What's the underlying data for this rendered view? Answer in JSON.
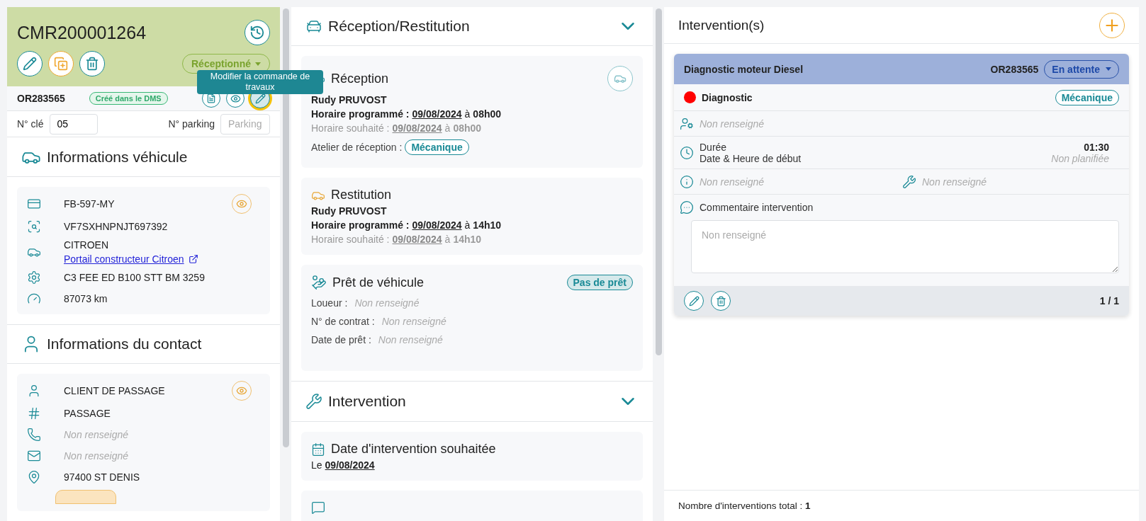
{
  "order": {
    "number": "CMR200001264",
    "status": "Réceptionné"
  },
  "work_order": {
    "number": "OR283565",
    "badge": "Créé dans le DMS",
    "edit_focused": true,
    "tooltip": "Modifier la commande de travaux"
  },
  "fields": [
    {
      "label": "N° clé",
      "value": "05"
    },
    {
      "label": "N° parking",
      "placeholder": "Parking"
    }
  ],
  "vehicle": {
    "title": "Informations véhicule",
    "rows": [
      {
        "kind": "plate",
        "text": "FB-597-MY",
        "missing": false
      },
      {
        "kind": "vin",
        "text": "VF7SXHNPNJT697392",
        "missing": false
      },
      {
        "kind": "brand",
        "text": "CITROEN",
        "missing": false,
        "link": "Portail constructeur Citroen"
      },
      {
        "kind": "engine",
        "text": "C3 FEE ED B100 STT BM 3259",
        "missing": false
      },
      {
        "kind": "mileage",
        "text": "87073 km",
        "missing": false
      }
    ]
  },
  "contact": {
    "title": "Informations du contact",
    "rows": [
      {
        "kind": "person",
        "text": "CLIENT DE PASSAGE",
        "missing": false
      },
      {
        "kind": "account",
        "text": "PASSAGE",
        "missing": false
      },
      {
        "kind": "phone",
        "text": "Non renseigné",
        "missing": true
      },
      {
        "kind": "email",
        "text": "Non renseigné",
        "missing": true
      },
      {
        "kind": "address",
        "text": "97400 ST DENIS",
        "missing": false
      }
    ]
  },
  "reception_restitution": {
    "title": "Réception/Restitution",
    "expanded": true,
    "reception": {
      "title": "Réception",
      "person": "Rudy PRUVOST",
      "scheduled": {
        "label": "Horaire programmé :",
        "date": "09/08/2024",
        "at": "à",
        "time": "08h00"
      },
      "desired": {
        "label": "Horaire souhaité :",
        "date": "09/08/2024",
        "at": "à",
        "time": "08h00"
      },
      "workshop": {
        "label": "Atelier de réception :",
        "value": "Mécanique"
      }
    },
    "restitution": {
      "title": "Restitution",
      "person": "Rudy PRUVOST",
      "scheduled": {
        "label": "Horaire programmé :",
        "date": "09/08/2024",
        "at": "à",
        "time": "14h10"
      },
      "desired": {
        "label": "Horaire souhaité :",
        "date": "09/08/2024",
        "at": "à",
        "time": "14h10"
      }
    },
    "loan": {
      "title": "Prêt de véhicule",
      "status": "Pas de prêt",
      "fields": [
        {
          "label": "Loueur :",
          "value": "Non renseigné",
          "missing": true
        },
        {
          "label": "N° de contrat :",
          "value": "Non renseigné",
          "missing": true
        },
        {
          "label": "Date de prêt :",
          "value": "Non renseigné",
          "missing": true
        }
      ]
    }
  },
  "intervention_section": {
    "title": "Intervention",
    "expanded": true,
    "desired_date": {
      "title": "Date d'intervention souhaitée",
      "prefix": "Le",
      "date": "09/08/2024"
    }
  },
  "interventions": {
    "title": "Intervention(s)",
    "cards": [
      {
        "title": "Diagnostic moteur Diesel",
        "order": "OR283565",
        "status": "En attente",
        "type": {
          "label": "Diagnostic",
          "color": "#ff0000"
        },
        "trade": "Mécanique",
        "technician": "Non renseigné",
        "duration_label": "Durée",
        "duration": "01:30",
        "start_label": "Date & Heure de début",
        "start": "Non planifiée",
        "info": "Non renseigné",
        "tool": "Non renseigné",
        "comment_label": "Commentaire intervention",
        "comment_placeholder": "Non renseigné",
        "pager": "1 / 1"
      }
    ],
    "total_label": "Nombre d'interventions total :",
    "total": "1"
  }
}
